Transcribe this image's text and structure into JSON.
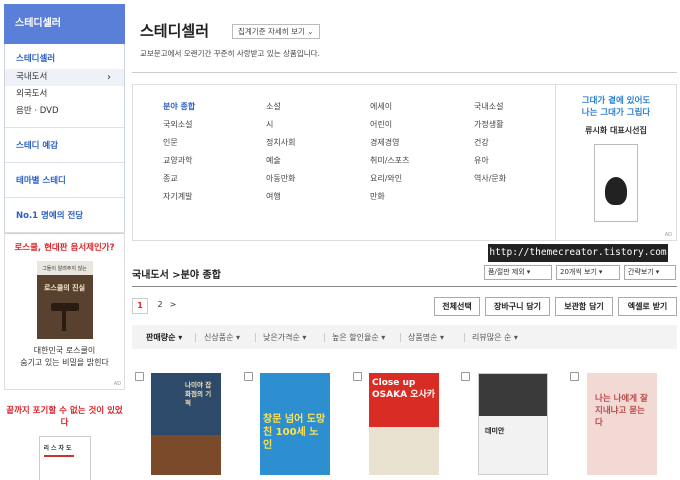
{
  "sidebar": {
    "header": "스테디셀러",
    "groups": [
      {
        "title": "스테디셀러",
        "items": [
          "국내도서",
          "외국도서",
          "음반 · DVD"
        ]
      },
      {
        "title": "스테디 예감"
      },
      {
        "title": "테마별 스테디"
      },
      {
        "title": "No.1 명예의 전당"
      }
    ]
  },
  "ad1": {
    "headline": "로스쿨, 현대판 음서제인가?",
    "book_top": "그들이 알려주지 않는",
    "book_title": "로스쿨의 진실",
    "caption_1": "대한민국 로스쿨이",
    "caption_2": "숨기고 있는 비밀을 밝힌다",
    "badge": "AD"
  },
  "ad2": {
    "headline": "끝까지 포기할 수 없는 것이 있었다",
    "book_title": "리스자도"
  },
  "main": {
    "title": "스테디셀러",
    "criteria_button": "집계기준 자세히 보기",
    "description": "교보문고에서 오랜기간 꾸준히 사랑받고 있는 상품입니다.",
    "categories": [
      [
        "분야 종합",
        "국외소설",
        "인문",
        "교양과학",
        "종교",
        "자기계발"
      ],
      [
        "소설",
        "시",
        "정치사회",
        "예술",
        "아동만화",
        "여행"
      ],
      [
        "에세이",
        "어린이",
        "경제경영",
        "취미/스포츠",
        "요리/와인",
        "만화"
      ],
      [
        "국내소설",
        "가정생활",
        "건강",
        "유아",
        "역사/문화"
      ]
    ],
    "cat_ad": {
      "headline_1": "그대가 곁에 있어도",
      "headline_2": "나는 그대가 그립다",
      "subtitle": "류시화 대표시선집",
      "badge": "AD"
    },
    "watermark": "http://themecreator.tistory.com",
    "breadcrumb": "국내도서 >분야 종합",
    "selects": [
      "품/절판 제외",
      "20개씩 보기",
      "간략보기"
    ],
    "pages": [
      "1",
      "2",
      ">"
    ],
    "actions": [
      "전체선택",
      "장바구니 담기",
      "보관함 담기",
      "엑셀로 받기"
    ],
    "sorts": [
      "판매량순",
      "신상품순",
      "낮은가격순",
      "높은 할인율순",
      "상품명순",
      "리뷰많은 순"
    ],
    "books": [
      {
        "title": "나미야 잡화점의 기적",
        "color": "#2e4a6a"
      },
      {
        "title": "창문 넘어 도망친 100세 노인",
        "color": "#2e8fd0"
      },
      {
        "title": "Close up OSAKA 오사카",
        "color": "#d82c24"
      },
      {
        "title": "데미안",
        "color": "#f2f2f2"
      },
      {
        "title": "나는 나에게 잘 지내냐고 묻는다",
        "color": "#f3d9d4"
      }
    ]
  }
}
